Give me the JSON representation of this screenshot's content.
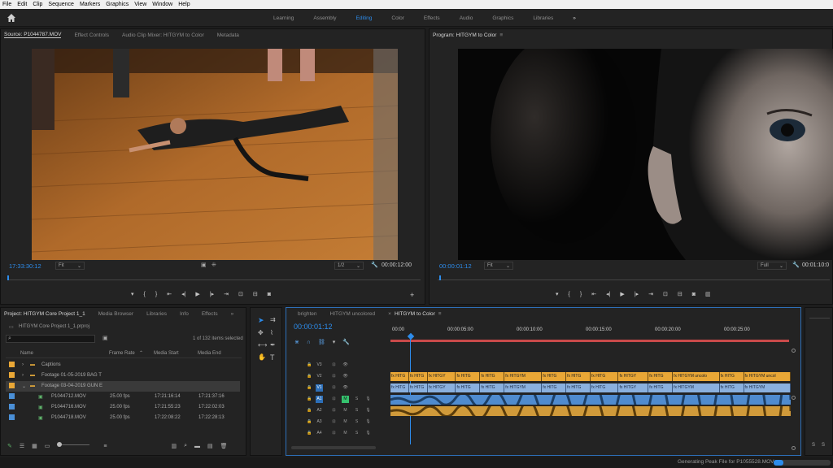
{
  "menu": [
    "File",
    "Edit",
    "Clip",
    "Sequence",
    "Markers",
    "Graphics",
    "View",
    "Window",
    "Help"
  ],
  "workspaces": {
    "tabs": [
      "Learning",
      "Assembly",
      "Editing",
      "Color",
      "Effects",
      "Audio",
      "Graphics",
      "Libraries"
    ],
    "active": "Editing",
    "more": "»"
  },
  "source": {
    "tabs": [
      "Source: P1044787.MOV",
      "Effect Controls",
      "Audio Clip Mixer: HITGYM to Color",
      "Metadata"
    ],
    "timecode": "17:33:30:12",
    "fit": "Fit",
    "resolution": "1/2",
    "duration": "00:00:12:00"
  },
  "program": {
    "tab": "Program: HITGYM to Color",
    "timecode": "00:00:01:12",
    "fit": "Fit",
    "resolution": "Full",
    "duration": "00:01:10:0"
  },
  "project": {
    "tabs": [
      "Project: HITGYM Core Project 1_1",
      "Media Browser",
      "Libraries",
      "Info",
      "Effects"
    ],
    "file": "HITGYM Core Project 1_1.prproj",
    "count": "1 of 132 items selected",
    "columns": [
      "Name",
      "Frame Rate",
      "Media Start",
      "Media End"
    ],
    "rows": [
      {
        "name": "Captions",
        "rate": "",
        "start": "",
        "end": "",
        "color": "#e9a736",
        "type": "folder"
      },
      {
        "name": "Footage 01-05-2019 BAG T",
        "rate": "",
        "start": "",
        "end": "",
        "color": "#e9a736",
        "type": "folder"
      },
      {
        "name": "Footage 03-04-2019 GUN E",
        "rate": "",
        "start": "",
        "end": "",
        "color": "#e9a736",
        "type": "folder-open"
      },
      {
        "name": "P1044712.MOV",
        "rate": "25.00 fps",
        "start": "17:21:16:14",
        "end": "17:21:37:16",
        "color": "#4a8fd6",
        "type": "clip"
      },
      {
        "name": "P1044716.MOV",
        "rate": "25.00 fps",
        "start": "17:21:55:23",
        "end": "17:22:02:03",
        "color": "#4a8fd6",
        "type": "clip"
      },
      {
        "name": "P1044718.MOV",
        "rate": "25.00 fps",
        "start": "17:22:08:22",
        "end": "17:22:28:13",
        "color": "#4a8fd6",
        "type": "clip"
      }
    ]
  },
  "timeline": {
    "tabs": [
      "brighten",
      "HITGYM uncolored",
      "HITGYM to Color"
    ],
    "active": "HITGYM to Color",
    "timecode": "00:00:01:12",
    "ruler": [
      "00:00",
      "00:00:05:00",
      "00:00:10:00",
      "00:00:15:00",
      "00:00:20:00",
      "00:00:25:00"
    ],
    "tracks": [
      "V3",
      "V2",
      "V1",
      "A1",
      "A2",
      "A3",
      "A4"
    ],
    "v2_clips": [
      "HITG",
      "HITG",
      "HITGY",
      "HITG",
      "HITG",
      "HITGYM",
      "HITG",
      "HITG",
      "HITG",
      "HITGY",
      "HITG",
      "HITGYM uncolo",
      "HITG",
      "HITGYM uncol"
    ],
    "v1_clips": [
      "HITG",
      "HITG",
      "HITGY",
      "HITG",
      "HITG",
      "HITGYM",
      "HITG",
      "HITG",
      "HITG",
      "HITGY",
      "HITG",
      "HITGYM",
      "HITG",
      "HITGYM"
    ]
  },
  "status": {
    "text": "Generating Peak File for P1055528.MOV"
  },
  "meters": {
    "solo_label": "S"
  },
  "colors": {
    "accent": "#2d8ceb",
    "video_clip": "#e9a736",
    "audio_clip": "#4f8bcf",
    "mute_on": "#35c26e"
  }
}
